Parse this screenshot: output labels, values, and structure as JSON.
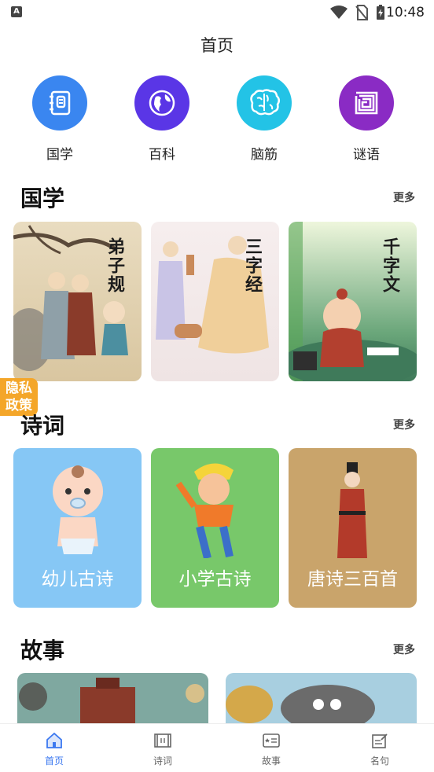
{
  "status_bar": {
    "app_badge": "A",
    "time": "10:48"
  },
  "header": {
    "title": "首页"
  },
  "quick_nav": [
    {
      "label": "国学",
      "icon": "book-icon",
      "color": "#3a86f0"
    },
    {
      "label": "百科",
      "icon": "globe-icon",
      "color": "#5a36e6"
    },
    {
      "label": "脑筋",
      "icon": "brain-icon",
      "color": "#23c3e6"
    },
    {
      "label": "谜语",
      "icon": "maze-icon",
      "color": "#8a2bc4"
    }
  ],
  "sections": {
    "guoxue": {
      "title": "国学",
      "more": "更多",
      "cards": [
        {
          "title": "弟子规"
        },
        {
          "title": "三字经"
        },
        {
          "title": "千字文"
        }
      ]
    },
    "shici": {
      "title": "诗词",
      "more": "更多",
      "cards": [
        {
          "title": "幼儿古诗",
          "bg": "#86c7f5"
        },
        {
          "title": "小学古诗",
          "bg": "#78c86a"
        },
        {
          "title": "唐诗三百首",
          "bg": "#c9a46b"
        }
      ]
    },
    "gushi": {
      "title": "故事",
      "more": "更多"
    }
  },
  "privacy_tab": {
    "line1": "隐私",
    "line2": "政策"
  },
  "tab_bar": [
    {
      "label": "首页",
      "icon": "home-icon",
      "active": true
    },
    {
      "label": "诗词",
      "icon": "scroll-icon",
      "active": false
    },
    {
      "label": "故事",
      "icon": "story-book-icon",
      "active": false
    },
    {
      "label": "名句",
      "icon": "note-edit-icon",
      "active": false
    }
  ]
}
